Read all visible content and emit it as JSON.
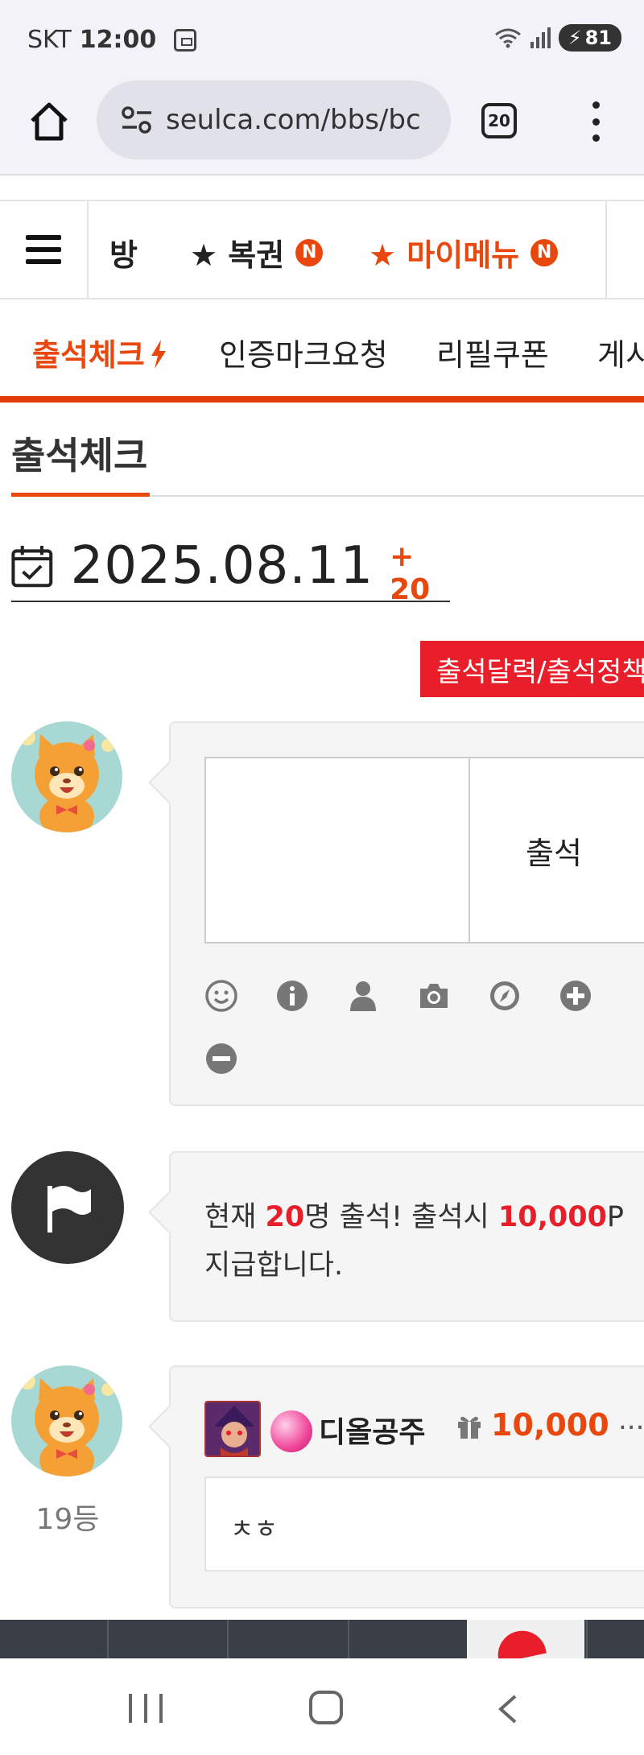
{
  "status_bar": {
    "carrier": "SKT",
    "time": "12:00",
    "battery": "81"
  },
  "browser": {
    "url": "seulca.com/bbs/bc",
    "tab_count": "20"
  },
  "top_menu": {
    "items": [
      {
        "label": "방",
        "badge": ""
      },
      {
        "label": "★ 복권",
        "badge": "N"
      },
      {
        "label": "★ 마이메뉴",
        "badge": "N"
      }
    ]
  },
  "sub_menu": {
    "items": [
      "출석체크",
      "인증마크요청",
      "리필쿠폰",
      "게시"
    ]
  },
  "page": {
    "title": "출석체크",
    "date": "2025.08.11",
    "date_count": "+ 20",
    "calendar_button": "출석달력/출석정책"
  },
  "write_box": {
    "submit_label": "출석",
    "tools": [
      "smile-icon",
      "info-icon",
      "user-icon",
      "camera-icon",
      "compass-icon",
      "plus-icon",
      "minus-icon"
    ]
  },
  "notice": {
    "part1": "현재 ",
    "count": "20",
    "part2": "명 출석! 출석시 ",
    "points": "10,000",
    "part3": "P",
    "line2": "지급합니다."
  },
  "post": {
    "rank": "19등",
    "nickname": "디올공주",
    "points": "10,000",
    "more": "...",
    "body": "ㅊㅎ"
  },
  "colors": {
    "accent": "#e8470d",
    "red": "#e81f2a",
    "dark": "#333333"
  }
}
